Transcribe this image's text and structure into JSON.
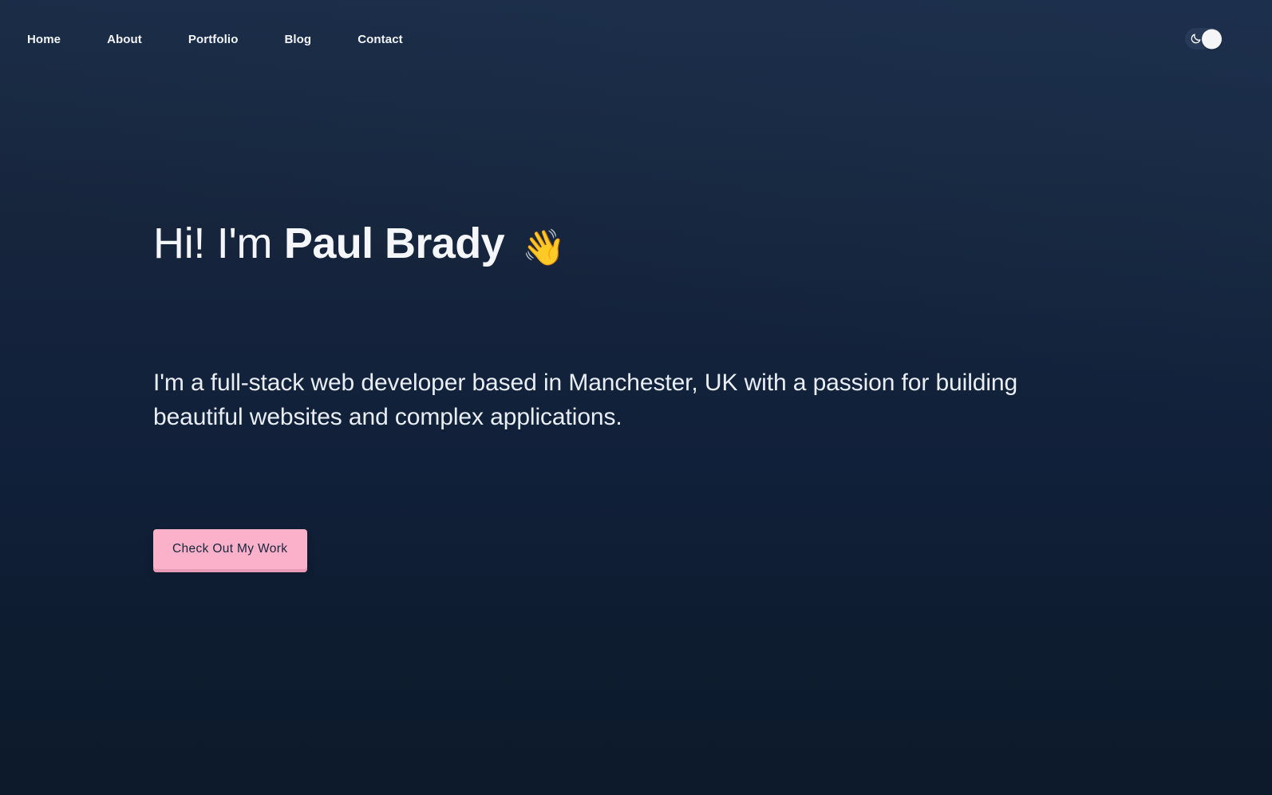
{
  "site": {
    "background_top_color": "#1a2a43",
    "background_bottom_color": "#0c1a2b"
  },
  "nav": {
    "items": [
      {
        "label": "Home"
      },
      {
        "label": "About"
      },
      {
        "label": "Portfolio"
      },
      {
        "label": "Blog"
      },
      {
        "label": "Contact"
      }
    ]
  },
  "theme_toggle": {
    "icon": "moon-icon",
    "state": "dark",
    "knob_color": "#f4f5f7",
    "track_color": "#273a57"
  },
  "hero": {
    "greeting": "Hi! I'm",
    "name": "Paul Brady",
    "emoji": "👋",
    "emoji_name": "waving-hand",
    "subtitle": "I'm a full-stack web developer based in Manchester, UK with a passion for building beautiful websites and complex applications.",
    "cta_label": "Check Out My Work",
    "cta_color": "#fbb1c9",
    "cta_text_color": "#17253c"
  }
}
